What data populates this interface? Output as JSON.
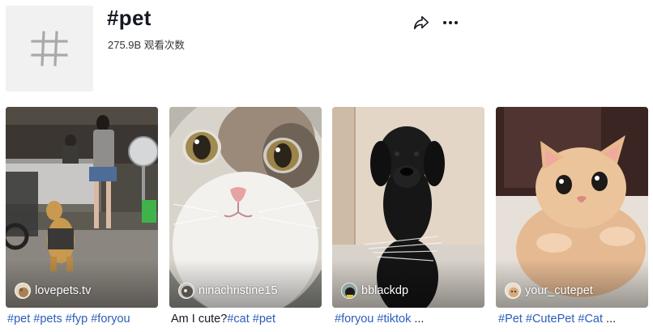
{
  "header": {
    "title": "#pet",
    "views_count": "275.9B",
    "views_label": "观看次数",
    "share_icon": "share-arrow-icon",
    "more_icon": "ellipsis-icon"
  },
  "videos": [
    {
      "author": "lovepets.tv",
      "caption_parts": [
        {
          "text": "#pet",
          "type": "tag"
        },
        {
          "text": " ",
          "type": "plain"
        },
        {
          "text": "#pets",
          "type": "tag"
        },
        {
          "text": " ",
          "type": "plain"
        },
        {
          "text": "#fyp",
          "type": "tag"
        },
        {
          "text": " ",
          "type": "plain"
        },
        {
          "text": "#foryou",
          "type": "tag"
        }
      ]
    },
    {
      "author": "ninachristine15",
      "caption_parts": [
        {
          "text": "Am I cute?",
          "type": "plain"
        },
        {
          "text": "#cat",
          "type": "tag"
        },
        {
          "text": " ",
          "type": "plain"
        },
        {
          "text": "#pet",
          "type": "tag"
        }
      ]
    },
    {
      "author": "bblackdp",
      "caption_parts": [
        {
          "text": "#foryou",
          "type": "tag"
        },
        {
          "text": " ",
          "type": "plain"
        },
        {
          "text": "#tiktok",
          "type": "tag"
        },
        {
          "text": " ...",
          "type": "plain"
        }
      ]
    },
    {
      "author": "your_cutepet",
      "caption_parts": [
        {
          "text": "#Pet",
          "type": "tag"
        },
        {
          "text": " ",
          "type": "plain"
        },
        {
          "text": "#CutePet",
          "type": "tag"
        },
        {
          "text": " ",
          "type": "plain"
        },
        {
          "text": "#Cat",
          "type": "tag"
        },
        {
          "text": " ...",
          "type": "plain"
        }
      ]
    }
  ]
}
